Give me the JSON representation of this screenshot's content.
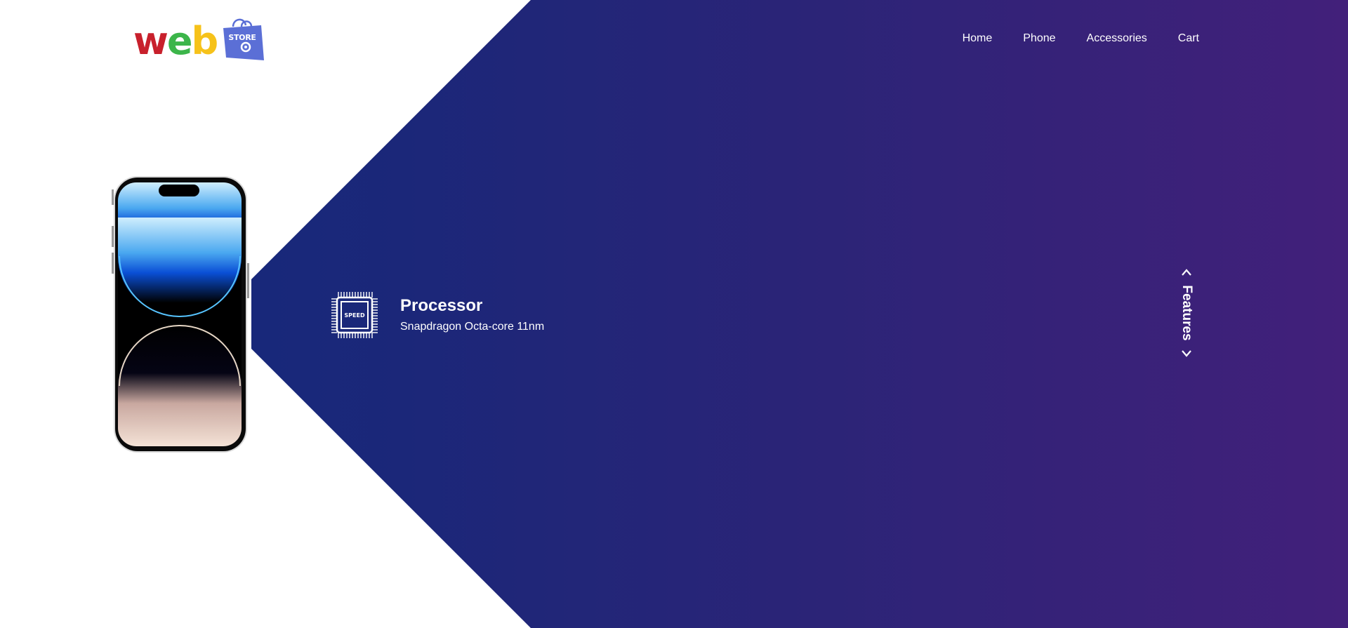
{
  "brand": {
    "logo_letters": [
      "w",
      "e",
      "b"
    ],
    "logo_colors": [
      "#c8202c",
      "#3cb54a",
      "#f6c21a"
    ],
    "bag_text": "STORE",
    "bag_color": "#5b6fd6"
  },
  "nav": {
    "items": [
      {
        "label": "Home"
      },
      {
        "label": "Phone"
      },
      {
        "label": "Accessories"
      },
      {
        "label": "Cart"
      }
    ]
  },
  "feature": {
    "icon": "processor-chip-icon",
    "icon_text": "SPEED",
    "title": "Processor",
    "description": "Snapdragon Octa-core 11nm"
  },
  "carousel": {
    "label": "Features",
    "prev_icon": "chevron-up-icon",
    "next_icon": "chevron-down-icon"
  },
  "colors": {
    "hero_gradient_start": "#132a7c",
    "hero_gradient_end": "#42207a",
    "text": "#ffffff"
  }
}
